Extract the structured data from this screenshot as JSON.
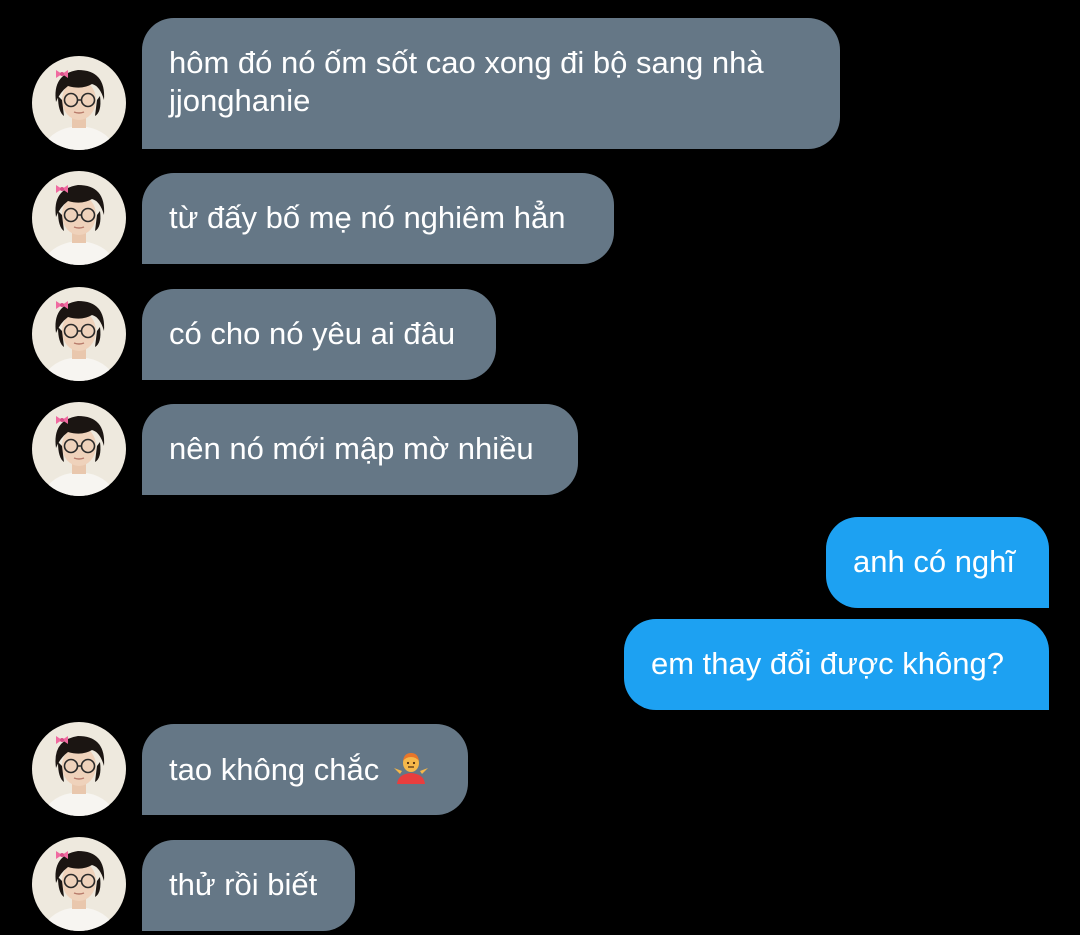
{
  "conversation": {
    "messages": [
      {
        "sender": "other",
        "text": "hôm đó nó ốm sốt cao xong đi bộ sang nhà",
        "text2": "jjonghanie"
      },
      {
        "sender": "other",
        "text": "từ đấy bố mẹ nó nghiêm hẳn"
      },
      {
        "sender": "other",
        "text": "có cho nó yêu ai đâu"
      },
      {
        "sender": "other",
        "text": "nên nó mới mập mờ nhiều"
      },
      {
        "sender": "me",
        "text": "anh có nghĩ"
      },
      {
        "sender": "me",
        "text": "em thay đổi được không?"
      },
      {
        "sender": "other",
        "text": "tao không chắc",
        "emoji": "person-shrugging-emoji"
      },
      {
        "sender": "other",
        "text": "thử rồi biết"
      }
    ]
  },
  "colors": {
    "background": "#000000",
    "incoming_bubble": "#657786",
    "outgoing_bubble": "#1da1f2",
    "text": "#ffffff"
  },
  "icons": {
    "avatar": "profile-photo-avatar",
    "emoji": "person-shrugging-emoji"
  }
}
